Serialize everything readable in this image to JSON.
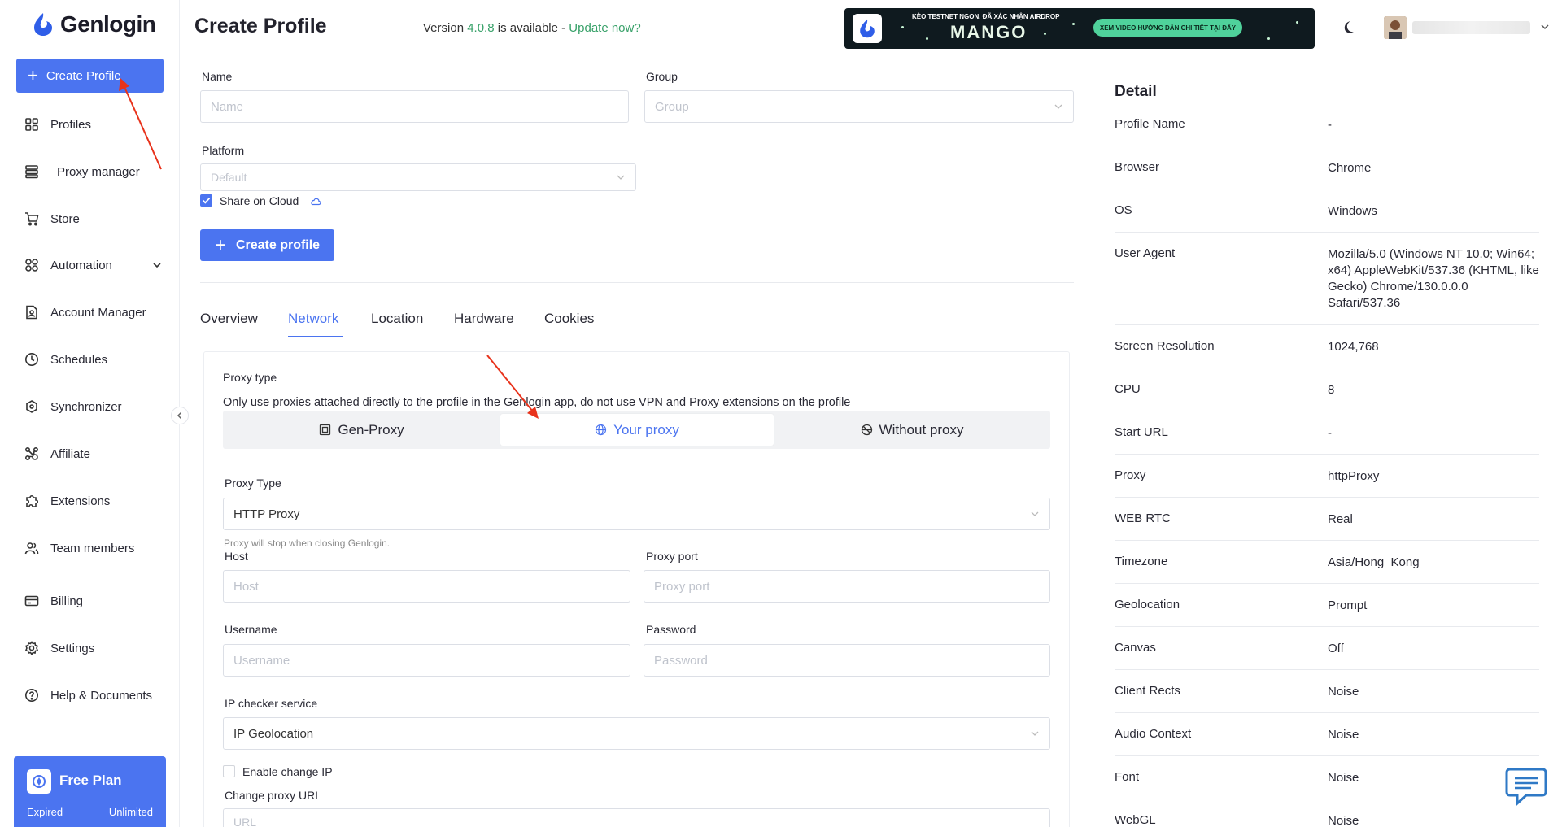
{
  "app": {
    "brand": "Genlogin"
  },
  "sidebar": {
    "create_label": "Create Profile",
    "items": [
      {
        "label": "Profiles",
        "icon": "grid-icon"
      },
      {
        "label": "Proxy manager",
        "icon": "server-icon"
      },
      {
        "label": "Store",
        "icon": "cart-icon"
      },
      {
        "label": "Automation",
        "icon": "automation-icon"
      },
      {
        "label": "Account Manager",
        "icon": "account-file-icon"
      },
      {
        "label": "Schedules",
        "icon": "clock-icon"
      },
      {
        "label": "Synchronizer",
        "icon": "sync-icon"
      },
      {
        "label": "Affiliate",
        "icon": "affiliate-icon"
      },
      {
        "label": "Extensions",
        "icon": "puzzle-icon"
      },
      {
        "label": "Team members",
        "icon": "team-icon"
      },
      {
        "label": "Billing",
        "icon": "card-icon"
      },
      {
        "label": "Settings",
        "icon": "gear-icon"
      },
      {
        "label": "Help & Documents",
        "icon": "help-icon"
      }
    ],
    "plan": {
      "title": "Free Plan",
      "status": "Expired",
      "limit": "Unlimited"
    }
  },
  "header": {
    "title": "Create Profile",
    "version_prefix": "Version ",
    "version_number": "4.0.8",
    "version_middle": " is available - ",
    "update_link": "Update now?",
    "banner": {
      "top_text": "KÈO TESTNET NGON, ĐÃ XÁC NHẬN AIRDROP",
      "brand": "MANGO",
      "pill": "XEM VIDEO HƯỚNG DẪN CHI TIẾT TẠI ĐÂY",
      "logo_caption": "Genlogin"
    }
  },
  "form": {
    "name_label": "Name",
    "name_placeholder": "Name",
    "group_label": "Group",
    "group_placeholder": "Group",
    "platform_label": "Platform",
    "platform_placeholder": "Default",
    "share_label": "Share on Cloud",
    "create_button": "Create profile"
  },
  "tabs": [
    "Overview",
    "Network",
    "Location",
    "Hardware",
    "Cookies"
  ],
  "active_tab": "Network",
  "network": {
    "proxy_type_heading": "Proxy type",
    "proxy_note": "Only use proxies attached directly to the profile in the Genlogin app, do not use VPN and Proxy extensions on the profile",
    "options": [
      "Gen-Proxy",
      "Your proxy",
      "Without proxy"
    ],
    "selected_option": "Your proxy",
    "proxy_type_label": "Proxy Type",
    "proxy_type_value": "HTTP Proxy",
    "stop_note": "Proxy will stop when closing Genlogin.",
    "host_label": "Host",
    "host_placeholder": "Host",
    "port_label": "Proxy port",
    "port_placeholder": "Proxy port",
    "username_label": "Username",
    "username_placeholder": "Username",
    "password_label": "Password",
    "password_placeholder": "Password",
    "ip_checker_label": "IP checker service",
    "ip_checker_value": "IP Geolocation",
    "enable_change_ip": "Enable change IP",
    "change_url_label": "Change proxy URL",
    "change_url_placeholder": "URL"
  },
  "detail": {
    "title": "Detail",
    "rows": [
      {
        "key": "Profile Name",
        "value": "-"
      },
      {
        "key": "Browser",
        "value": "Chrome"
      },
      {
        "key": "OS",
        "value": "Windows"
      },
      {
        "key": "User Agent",
        "value": "Mozilla/5.0 (Windows NT 10.0; Win64; x64) AppleWebKit/537.36 (KHTML, like Gecko) Chrome/130.0.0.0 Safari/537.36"
      },
      {
        "key": "Screen Resolution",
        "value": "1024,768"
      },
      {
        "key": "CPU",
        "value": "8"
      },
      {
        "key": "Start URL",
        "value": "-"
      },
      {
        "key": "Proxy",
        "value": "httpProxy"
      },
      {
        "key": "WEB RTC",
        "value": "Real"
      },
      {
        "key": "Timezone",
        "value": "Asia/Hong_Kong"
      },
      {
        "key": "Geolocation",
        "value": "Prompt"
      },
      {
        "key": "Canvas",
        "value": "Off"
      },
      {
        "key": "Client Rects",
        "value": "Noise"
      },
      {
        "key": "Audio Context",
        "value": "Noise"
      },
      {
        "key": "Font",
        "value": "Noise"
      },
      {
        "key": "WebGL",
        "value": "Noise"
      }
    ]
  },
  "colors": {
    "accent": "#4b74f0",
    "success": "#38a169",
    "annotation": "#e8331c"
  }
}
